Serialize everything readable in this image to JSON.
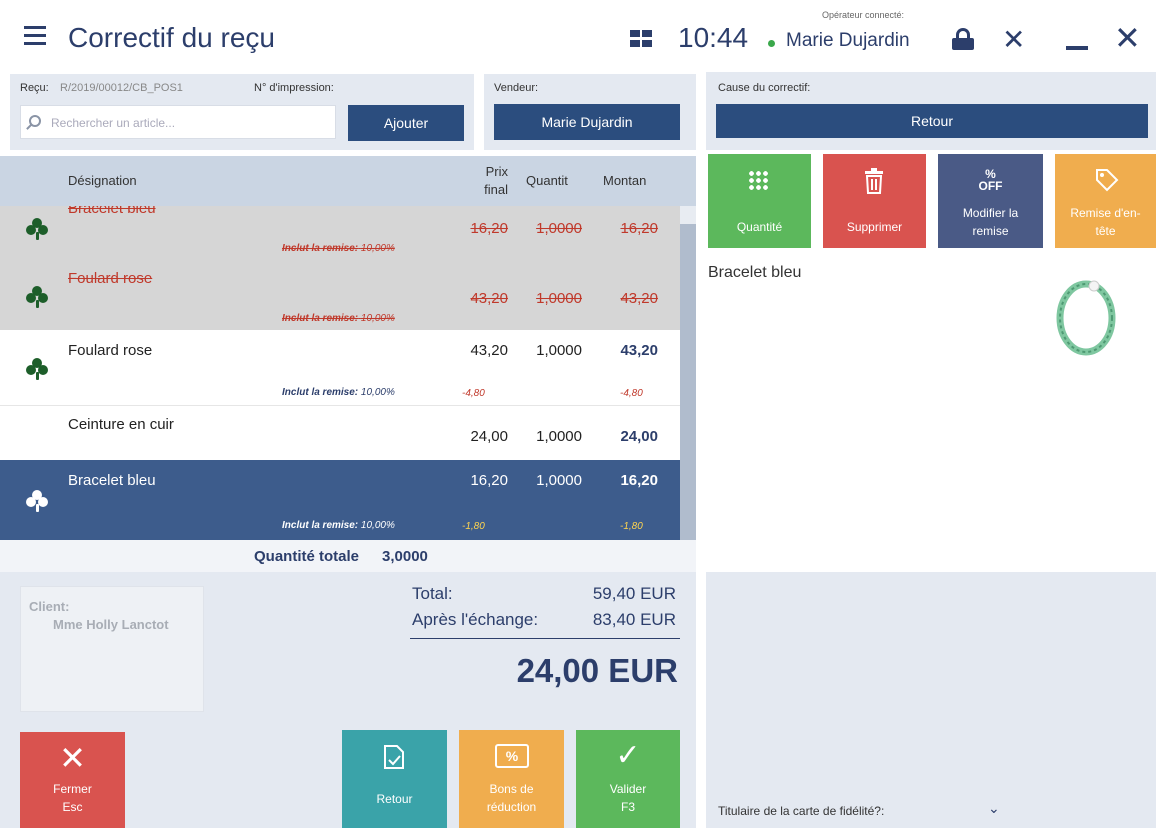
{
  "header": {
    "title": "Correctif du reçu",
    "time": "10:44",
    "operator_label": "Opérateur connecté:",
    "operator_name": "Marie Dujardin"
  },
  "receipt": {
    "label": "Reçu:",
    "number": "R/2019/00012/CB_POS1",
    "print_label": "N° d'impression:",
    "search_placeholder": "Rechercher un article...",
    "add_button": "Ajouter"
  },
  "seller": {
    "label": "Vendeur:",
    "value": "Marie Dujardin"
  },
  "cause": {
    "label": "Cause du correctif:",
    "value": "Retour"
  },
  "table": {
    "col_name": "Désignation",
    "col_price_1": "Prix",
    "col_price_2": "final",
    "col_qty": "Quantit",
    "col_amount": "Montan",
    "rows": [
      {
        "name": "Bracelet bleu",
        "price": "16,20",
        "qty": "1,0000",
        "amount": "16,20",
        "discount_label": "Inclut la remise:",
        "discount": "10,00%",
        "discount_value": "",
        "discount_amount": ""
      },
      {
        "name": "Foulard rose",
        "price": "43,20",
        "qty": "1,0000",
        "amount": "43,20",
        "discount_label": "Inclut la remise:",
        "discount": "10,00%",
        "discount_value": "",
        "discount_amount": ""
      },
      {
        "name": "Foulard rose",
        "price": "43,20",
        "qty": "1,0000",
        "amount": "43,20",
        "discount_label": "Inclut la remise:",
        "discount": "10,00%",
        "discount_value": "-4,80",
        "discount_amount": "-4,80"
      },
      {
        "name": "Ceinture en cuir",
        "price": "24,00",
        "qty": "1,0000",
        "amount": "24,00"
      },
      {
        "name": "Bracelet bleu",
        "price": "16,20",
        "qty": "1,0000",
        "amount": "16,20",
        "discount_label": "Inclut la remise:",
        "discount": "10,00%",
        "discount_value": "-1,80",
        "discount_amount": "-1,80"
      }
    ]
  },
  "total_qty": {
    "label": "Quantité totale",
    "value": "3,0000"
  },
  "client": {
    "label": "Client:",
    "name": "Mme Holly Lanctot"
  },
  "totals": {
    "total_label": "Total:",
    "total_value": "59,40 EUR",
    "after_label": "Après l'échange:",
    "after_value": "83,40 EUR",
    "grand": "24,00 EUR"
  },
  "actions": {
    "close_1": "Fermer",
    "close_2": "Esc",
    "return": "Retour",
    "vouchers_1": "Bons de",
    "vouchers_2": "réduction",
    "validate_1": "Valider",
    "validate_2": "F3"
  },
  "tiles": {
    "quantity": "Quantité",
    "delete": "Supprimer",
    "discount_1": "Modifier la",
    "discount_2": "remise",
    "off_pct": "%",
    "off_text": "OFF",
    "header_discount_1": "Remise d'en-",
    "header_discount_2": "tête"
  },
  "product": {
    "name": "Bracelet bleu"
  },
  "loyalty": {
    "label": "Titulaire de la carte de fidélité?:"
  },
  "colors": {
    "navy": "#2b4d7e",
    "green": "#5cb85c",
    "red": "#d9534f",
    "teal": "#3aa3a9",
    "orange": "#f0ad4e",
    "slate": "#4a5a86",
    "discount_red": "#c0392b",
    "discount_yellow": "#ffd54f"
  },
  "icons": [
    "menu-icon",
    "grid-icon",
    "lock-icon",
    "tools-icon",
    "minimize-icon",
    "close-icon",
    "search-icon",
    "clover-icon",
    "grid-dots-icon",
    "trash-icon",
    "percent-off-icon",
    "tag-icon",
    "x-icon",
    "return-doc-icon",
    "voucher-icon",
    "check-icon",
    "chevron-down-icon"
  ]
}
